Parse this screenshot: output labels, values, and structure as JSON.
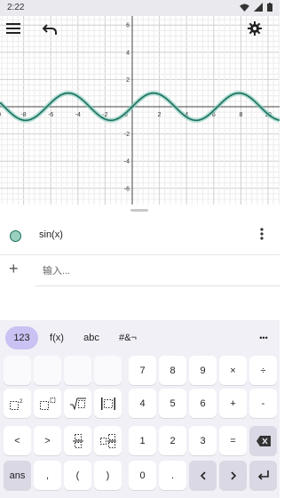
{
  "status": {
    "time": "2:22"
  },
  "graph": {
    "xticks": [
      "-10",
      "-8",
      "-6",
      "-4",
      "-2",
      "0",
      "2",
      "4",
      "6",
      "8",
      "10"
    ],
    "yticks": [
      "6",
      "4",
      "2",
      "-2",
      "-4",
      "-6"
    ],
    "curve_color": "#1b6f5f",
    "highlight_color": "#8ed0bf"
  },
  "chart_data": {
    "type": "line",
    "xlim": [
      -10,
      10
    ],
    "ylim": [
      -7,
      7
    ],
    "grid": true,
    "series": [
      {
        "name": "sin(x)",
        "function": "sin(x)"
      }
    ]
  },
  "algebra": {
    "expression": "sin(x)",
    "input_placeholder": "输入..."
  },
  "keyboard": {
    "tabs": [
      {
        "label": "123",
        "active": true
      },
      {
        "label": "f(x)",
        "active": false
      },
      {
        "label": "abc",
        "active": false
      },
      {
        "label": "#&¬",
        "active": false
      }
    ],
    "more_label": "•••",
    "keys": {
      "k7": "7",
      "k8": "8",
      "k9": "9",
      "times": "×",
      "divide": "÷",
      "k4": "4",
      "k5": "5",
      "k6": "6",
      "plus": "+",
      "minus": "-",
      "lt": "<",
      "gt": ">",
      "k1": "1",
      "k2": "2",
      "k3": "3",
      "equals": "=",
      "ans": "ans",
      "comma": ",",
      "lparen": "(",
      "rparen": ")",
      "k0": "0",
      "dot": "."
    }
  }
}
